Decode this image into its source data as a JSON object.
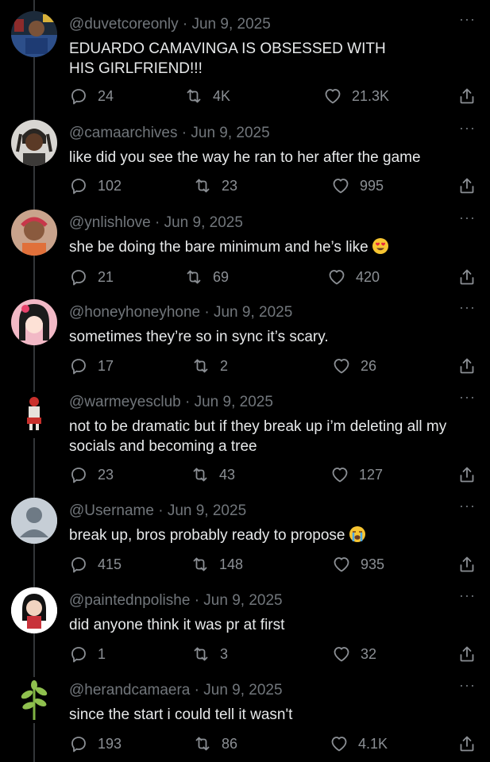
{
  "posts": [
    {
      "handle": "@duvetcoreonly",
      "date": "Jun 9, 2025",
      "text": "EDUARDO CAMAVINGA IS OBSESSED WITH HIS GIRLFRIEND!!!",
      "replies": "24",
      "reposts": "4K",
      "likes": "21.3K"
    },
    {
      "handle": "@camaarchives",
      "date": "Jun 9, 2025",
      "text": "like did you see the way he ran to her after the game",
      "replies": "102",
      "reposts": "23",
      "likes": "995"
    },
    {
      "handle": "@ynlishlove",
      "date": "Jun 9, 2025",
      "text": "she be doing the bare minimum and he’s like",
      "emoji": "heart-eyes-emoji",
      "replies": "21",
      "reposts": "69",
      "likes": "420"
    },
    {
      "handle": "@honeyhoneyhone",
      "date": "Jun 9, 2025",
      "text": "sometimes they’re so in sync it’s scary.",
      "replies": "17",
      "reposts": "2",
      "likes": "26"
    },
    {
      "handle": "@warmeyesclub",
      "date": "Jun 9, 2025",
      "text": "not to be dramatic but if they break up i’m deleting all my socials and becoming a tree",
      "replies": "23",
      "reposts": "43",
      "likes": "127"
    },
    {
      "handle": "@Username",
      "date": "Jun 9, 2025",
      "text": "break up, bros probably ready to propose",
      "emoji": "loudly-crying-emoji",
      "replies": "415",
      "reposts": "148",
      "likes": "935"
    },
    {
      "handle": "@paintednpolishe",
      "date": "Jun 9, 2025",
      "text": "did anyone think it was pr at first",
      "replies": "1",
      "reposts": "3",
      "likes": "32"
    },
    {
      "handle": "@herandcamaera",
      "date": "Jun 9, 2025",
      "text": "since the start i could tell it wasn't",
      "replies": "193",
      "reposts": "86",
      "likes": "4.1K"
    }
  ],
  "separator": "·",
  "more_glyph": "···",
  "colors": {
    "background": "#000000",
    "text": "#e7e9ea",
    "muted": "#71767b",
    "thread_line": "#333639"
  },
  "icons": [
    "reply-icon",
    "repost-icon",
    "like-icon",
    "share-icon",
    "more-icon"
  ]
}
